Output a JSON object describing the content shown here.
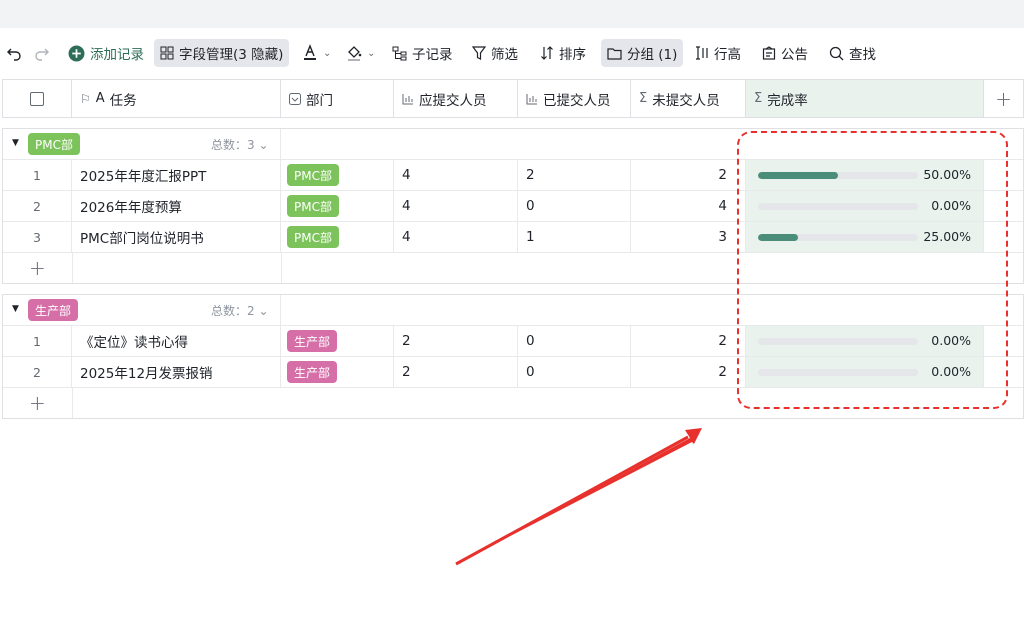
{
  "toolbar": {
    "add_record": "添加记录",
    "field_manage": "字段管理(3 隐藏)",
    "sub_record": "子记录",
    "filter": "筛选",
    "sort": "排序",
    "group": "分组 (1)",
    "row_height": "行高",
    "notice": "公告",
    "find": "查找"
  },
  "columns": {
    "task": "任务",
    "dept": "部门",
    "should": "应提交人员",
    "submitted": "已提交人员",
    "not_submitted": "未提交人员",
    "rate": "完成率"
  },
  "groups": [
    {
      "tag": "PMC部",
      "tag_color": "#7dc35b",
      "count": "总数：3",
      "rows": [
        {
          "idx": "1",
          "task": "2025年年度汇报PPT",
          "dept": "PMC部",
          "should": "4",
          "submitted": "2",
          "not": "2",
          "rate": 0.5,
          "rate_text": "50.00%"
        },
        {
          "idx": "2",
          "task": "2026年年度预算",
          "dept": "PMC部",
          "should": "4",
          "submitted": "0",
          "not": "4",
          "rate": 0,
          "rate_text": "0.00%"
        },
        {
          "idx": "3",
          "task": "PMC部门岗位说明书",
          "dept": "PMC部",
          "should": "4",
          "submitted": "1",
          "not": "3",
          "rate": 0.25,
          "rate_text": "25.00%"
        }
      ]
    },
    {
      "tag": "生产部",
      "tag_color": "#d66fa8",
      "count": "总数：2",
      "rows": [
        {
          "idx": "1",
          "task": "《定位》读书心得",
          "dept": "生产部",
          "should": "2",
          "submitted": "0",
          "not": "2",
          "rate": 0,
          "rate_text": "0.00%"
        },
        {
          "idx": "2",
          "task": "2025年12月发票报销",
          "dept": "生产部",
          "should": "2",
          "submitted": "0",
          "not": "2",
          "rate": 0,
          "rate_text": "0.00%"
        }
      ]
    }
  ],
  "colors": {
    "accent": "#4a8d78",
    "annotation": "#e8312c"
  }
}
